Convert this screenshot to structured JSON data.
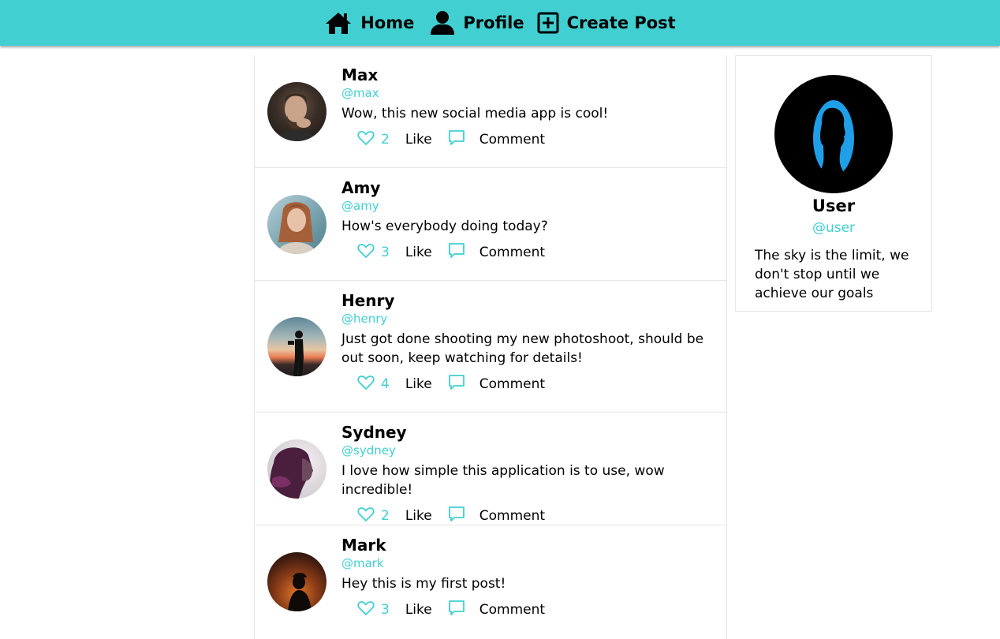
{
  "nav": {
    "items": [
      {
        "label": "Home",
        "icon": "home-icon"
      },
      {
        "label": "Profile",
        "icon": "user-icon"
      },
      {
        "label": "Create Post",
        "icon": "plus-square-icon"
      }
    ],
    "background": "#41cfd1"
  },
  "accent": "#41cfd1",
  "posts": [
    {
      "name": "Max",
      "handle": "@max",
      "text": "Wow, this new social media app is cool!",
      "likes": "2",
      "like_label": "Like",
      "comment_label": "Comment"
    },
    {
      "name": "Amy",
      "handle": "@amy",
      "text": "How's everybody doing today?",
      "likes": "3",
      "like_label": "Like",
      "comment_label": "Comment"
    },
    {
      "name": "Henry",
      "handle": "@henry",
      "text": "Just got done shooting my new photoshoot, should be out soon, keep watching for details!",
      "likes": "4",
      "like_label": "Like",
      "comment_label": "Comment"
    },
    {
      "name": "Sydney",
      "handle": "@sydney",
      "text": "I love how simple this application is to use, wow incredible!",
      "likes": "2",
      "like_label": "Like",
      "comment_label": "Comment"
    },
    {
      "name": "Mark",
      "handle": "@mark",
      "text": "Hey this is my first post!",
      "likes": "3",
      "like_label": "Like",
      "comment_label": "Comment"
    }
  ],
  "profile": {
    "name": "User",
    "handle": "@user",
    "bio": "The sky is the limit, we don't stop until we achieve our goals"
  }
}
